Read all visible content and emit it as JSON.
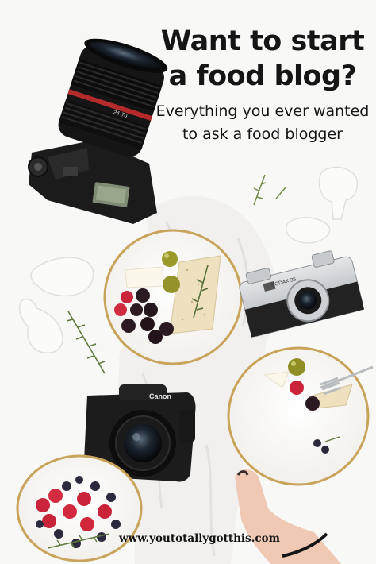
{
  "headline": {
    "title": "Want to start a food blog?",
    "subtitle": "Everything you ever wanted to ask a food blogger"
  },
  "camera_labels": {
    "top_camera_brand": "",
    "lens_text": "24-70",
    "kodak": "KODAK 35",
    "canon": "Canon"
  },
  "footer": {
    "url": "www.youtotallygotthis.com"
  },
  "colors": {
    "background": "#f8f8f7",
    "text": "#151515",
    "plate_rim": "#c9a35a",
    "camera_body": "#1c1c1c",
    "linen": "#f1f0ee",
    "berry_red": "#c9243a",
    "olive": "#8a8a24"
  }
}
